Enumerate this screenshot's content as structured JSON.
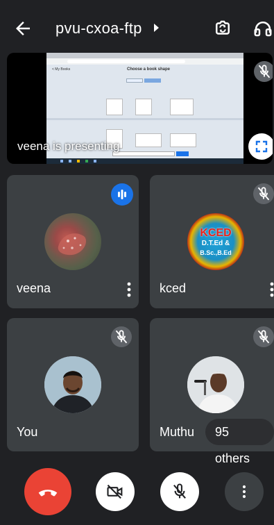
{
  "header": {
    "meeting_code": "pvu-cxoa-ftp",
    "back_icon": "arrow-back-icon",
    "switch_camera_icon": "switch-camera-icon",
    "audio_output_icon": "headphones-icon"
  },
  "presentation": {
    "label": "veena is presenting",
    "mic_state": "muted",
    "fullscreen_icon": "fullscreen-icon",
    "shared_screen": {
      "breadcrumb": "< My Books",
      "heading": "Choose a book shape"
    }
  },
  "participants": [
    {
      "name": "veena",
      "status_icon": "speaking-icon",
      "avatar": "photo"
    },
    {
      "name": "kced",
      "status_icon": "mic-off-icon",
      "avatar": "logo"
    },
    {
      "name": "You",
      "status_icon": "mic-off-icon",
      "avatar": "photo"
    },
    {
      "name": "Muthu",
      "status_icon": "mic-off-icon",
      "avatar": "photo"
    }
  ],
  "kced_logo": {
    "line1": "KCED",
    "line2": "D.T.Ed &",
    "line3": "B.Sc.,B.Ed"
  },
  "others_chip": "95 others",
  "controls": {
    "end_call_icon": "end-call-icon",
    "camera_icon": "videocam-off-icon",
    "mic_icon": "mic-off-icon",
    "more_icon": "more-vert-icon"
  },
  "colors": {
    "background": "#202124",
    "tile": "#3c4043",
    "end_call": "#ea4335",
    "accent": "#1a73e8"
  }
}
